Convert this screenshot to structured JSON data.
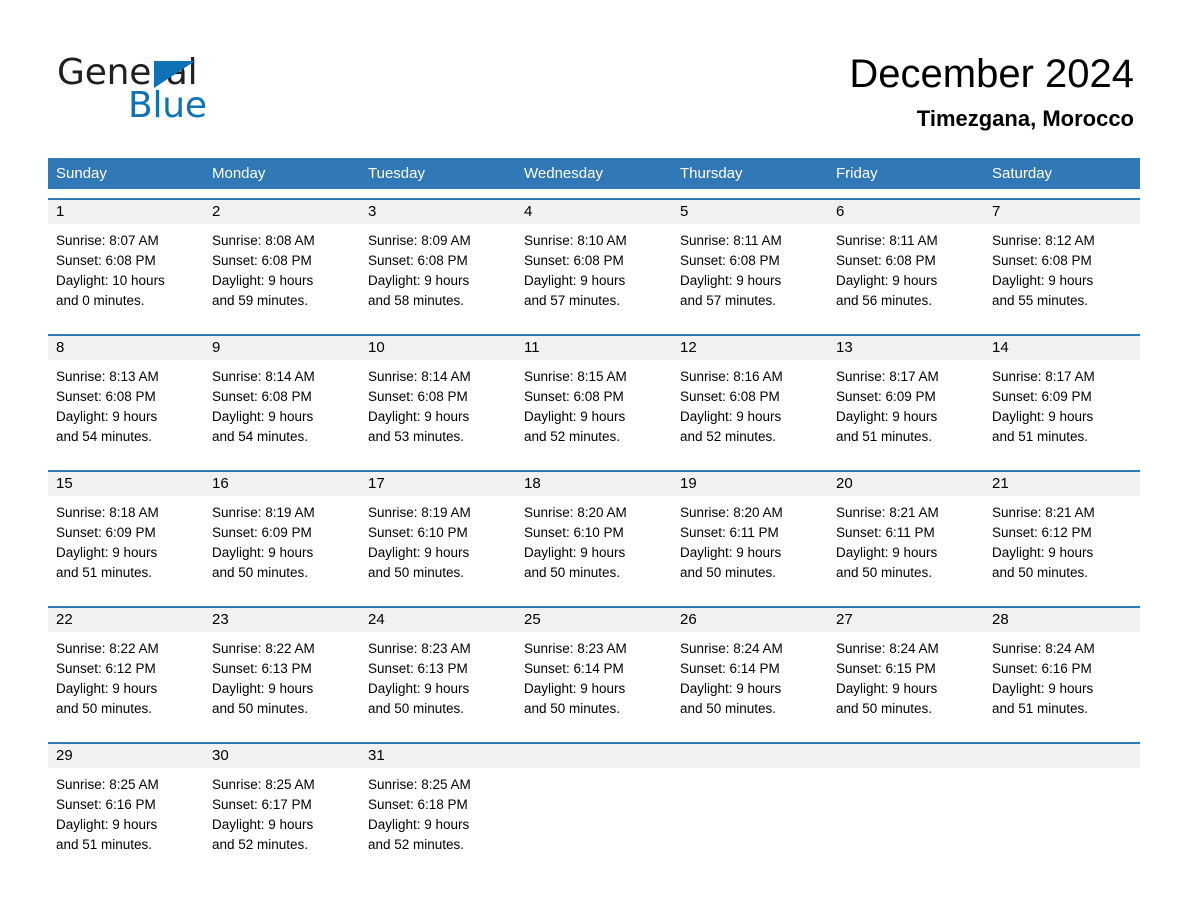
{
  "brand": {
    "name_part1": "General",
    "name_part2": "Blue",
    "accent_color": "#0f72b5",
    "triangle_icon": "triangle-icon"
  },
  "header": {
    "month_title": "December 2024",
    "location": "Timezgana, Morocco"
  },
  "theme": {
    "header_blue": "#3178b6",
    "row_band_gray": "#f1f1f1",
    "text_black": "#000000"
  },
  "calendar": {
    "day_headers": [
      "Sunday",
      "Monday",
      "Tuesday",
      "Wednesday",
      "Thursday",
      "Friday",
      "Saturday"
    ],
    "weeks": [
      {
        "numbers": [
          "1",
          "2",
          "3",
          "4",
          "5",
          "6",
          "7"
        ],
        "cells": [
          {
            "sunrise": "Sunrise: 8:07 AM",
            "sunset": "Sunset: 6:08 PM",
            "daylight1": "Daylight: 10 hours",
            "daylight2": "and 0 minutes."
          },
          {
            "sunrise": "Sunrise: 8:08 AM",
            "sunset": "Sunset: 6:08 PM",
            "daylight1": "Daylight: 9 hours",
            "daylight2": "and 59 minutes."
          },
          {
            "sunrise": "Sunrise: 8:09 AM",
            "sunset": "Sunset: 6:08 PM",
            "daylight1": "Daylight: 9 hours",
            "daylight2": "and 58 minutes."
          },
          {
            "sunrise": "Sunrise: 8:10 AM",
            "sunset": "Sunset: 6:08 PM",
            "daylight1": "Daylight: 9 hours",
            "daylight2": "and 57 minutes."
          },
          {
            "sunrise": "Sunrise: 8:11 AM",
            "sunset": "Sunset: 6:08 PM",
            "daylight1": "Daylight: 9 hours",
            "daylight2": "and 57 minutes."
          },
          {
            "sunrise": "Sunrise: 8:11 AM",
            "sunset": "Sunset: 6:08 PM",
            "daylight1": "Daylight: 9 hours",
            "daylight2": "and 56 minutes."
          },
          {
            "sunrise": "Sunrise: 8:12 AM",
            "sunset": "Sunset: 6:08 PM",
            "daylight1": "Daylight: 9 hours",
            "daylight2": "and 55 minutes."
          }
        ]
      },
      {
        "numbers": [
          "8",
          "9",
          "10",
          "11",
          "12",
          "13",
          "14"
        ],
        "cells": [
          {
            "sunrise": "Sunrise: 8:13 AM",
            "sunset": "Sunset: 6:08 PM",
            "daylight1": "Daylight: 9 hours",
            "daylight2": "and 54 minutes."
          },
          {
            "sunrise": "Sunrise: 8:14 AM",
            "sunset": "Sunset: 6:08 PM",
            "daylight1": "Daylight: 9 hours",
            "daylight2": "and 54 minutes."
          },
          {
            "sunrise": "Sunrise: 8:14 AM",
            "sunset": "Sunset: 6:08 PM",
            "daylight1": "Daylight: 9 hours",
            "daylight2": "and 53 minutes."
          },
          {
            "sunrise": "Sunrise: 8:15 AM",
            "sunset": "Sunset: 6:08 PM",
            "daylight1": "Daylight: 9 hours",
            "daylight2": "and 52 minutes."
          },
          {
            "sunrise": "Sunrise: 8:16 AM",
            "sunset": "Sunset: 6:08 PM",
            "daylight1": "Daylight: 9 hours",
            "daylight2": "and 52 minutes."
          },
          {
            "sunrise": "Sunrise: 8:17 AM",
            "sunset": "Sunset: 6:09 PM",
            "daylight1": "Daylight: 9 hours",
            "daylight2": "and 51 minutes."
          },
          {
            "sunrise": "Sunrise: 8:17 AM",
            "sunset": "Sunset: 6:09 PM",
            "daylight1": "Daylight: 9 hours",
            "daylight2": "and 51 minutes."
          }
        ]
      },
      {
        "numbers": [
          "15",
          "16",
          "17",
          "18",
          "19",
          "20",
          "21"
        ],
        "cells": [
          {
            "sunrise": "Sunrise: 8:18 AM",
            "sunset": "Sunset: 6:09 PM",
            "daylight1": "Daylight: 9 hours",
            "daylight2": "and 51 minutes."
          },
          {
            "sunrise": "Sunrise: 8:19 AM",
            "sunset": "Sunset: 6:09 PM",
            "daylight1": "Daylight: 9 hours",
            "daylight2": "and 50 minutes."
          },
          {
            "sunrise": "Sunrise: 8:19 AM",
            "sunset": "Sunset: 6:10 PM",
            "daylight1": "Daylight: 9 hours",
            "daylight2": "and 50 minutes."
          },
          {
            "sunrise": "Sunrise: 8:20 AM",
            "sunset": "Sunset: 6:10 PM",
            "daylight1": "Daylight: 9 hours",
            "daylight2": "and 50 minutes."
          },
          {
            "sunrise": "Sunrise: 8:20 AM",
            "sunset": "Sunset: 6:11 PM",
            "daylight1": "Daylight: 9 hours",
            "daylight2": "and 50 minutes."
          },
          {
            "sunrise": "Sunrise: 8:21 AM",
            "sunset": "Sunset: 6:11 PM",
            "daylight1": "Daylight: 9 hours",
            "daylight2": "and 50 minutes."
          },
          {
            "sunrise": "Sunrise: 8:21 AM",
            "sunset": "Sunset: 6:12 PM",
            "daylight1": "Daylight: 9 hours",
            "daylight2": "and 50 minutes."
          }
        ]
      },
      {
        "numbers": [
          "22",
          "23",
          "24",
          "25",
          "26",
          "27",
          "28"
        ],
        "cells": [
          {
            "sunrise": "Sunrise: 8:22 AM",
            "sunset": "Sunset: 6:12 PM",
            "daylight1": "Daylight: 9 hours",
            "daylight2": "and 50 minutes."
          },
          {
            "sunrise": "Sunrise: 8:22 AM",
            "sunset": "Sunset: 6:13 PM",
            "daylight1": "Daylight: 9 hours",
            "daylight2": "and 50 minutes."
          },
          {
            "sunrise": "Sunrise: 8:23 AM",
            "sunset": "Sunset: 6:13 PM",
            "daylight1": "Daylight: 9 hours",
            "daylight2": "and 50 minutes."
          },
          {
            "sunrise": "Sunrise: 8:23 AM",
            "sunset": "Sunset: 6:14 PM",
            "daylight1": "Daylight: 9 hours",
            "daylight2": "and 50 minutes."
          },
          {
            "sunrise": "Sunrise: 8:24 AM",
            "sunset": "Sunset: 6:14 PM",
            "daylight1": "Daylight: 9 hours",
            "daylight2": "and 50 minutes."
          },
          {
            "sunrise": "Sunrise: 8:24 AM",
            "sunset": "Sunset: 6:15 PM",
            "daylight1": "Daylight: 9 hours",
            "daylight2": "and 50 minutes."
          },
          {
            "sunrise": "Sunrise: 8:24 AM",
            "sunset": "Sunset: 6:16 PM",
            "daylight1": "Daylight: 9 hours",
            "daylight2": "and 51 minutes."
          }
        ]
      },
      {
        "numbers": [
          "29",
          "30",
          "31",
          "",
          "",
          "",
          ""
        ],
        "cells": [
          {
            "sunrise": "Sunrise: 8:25 AM",
            "sunset": "Sunset: 6:16 PM",
            "daylight1": "Daylight: 9 hours",
            "daylight2": "and 51 minutes."
          },
          {
            "sunrise": "Sunrise: 8:25 AM",
            "sunset": "Sunset: 6:17 PM",
            "daylight1": "Daylight: 9 hours",
            "daylight2": "and 52 minutes."
          },
          {
            "sunrise": "Sunrise: 8:25 AM",
            "sunset": "Sunset: 6:18 PM",
            "daylight1": "Daylight: 9 hours",
            "daylight2": "and 52 minutes."
          },
          {
            "sunrise": "",
            "sunset": "",
            "daylight1": "",
            "daylight2": ""
          },
          {
            "sunrise": "",
            "sunset": "",
            "daylight1": "",
            "daylight2": ""
          },
          {
            "sunrise": "",
            "sunset": "",
            "daylight1": "",
            "daylight2": ""
          },
          {
            "sunrise": "",
            "sunset": "",
            "daylight1": "",
            "daylight2": ""
          }
        ]
      }
    ]
  }
}
